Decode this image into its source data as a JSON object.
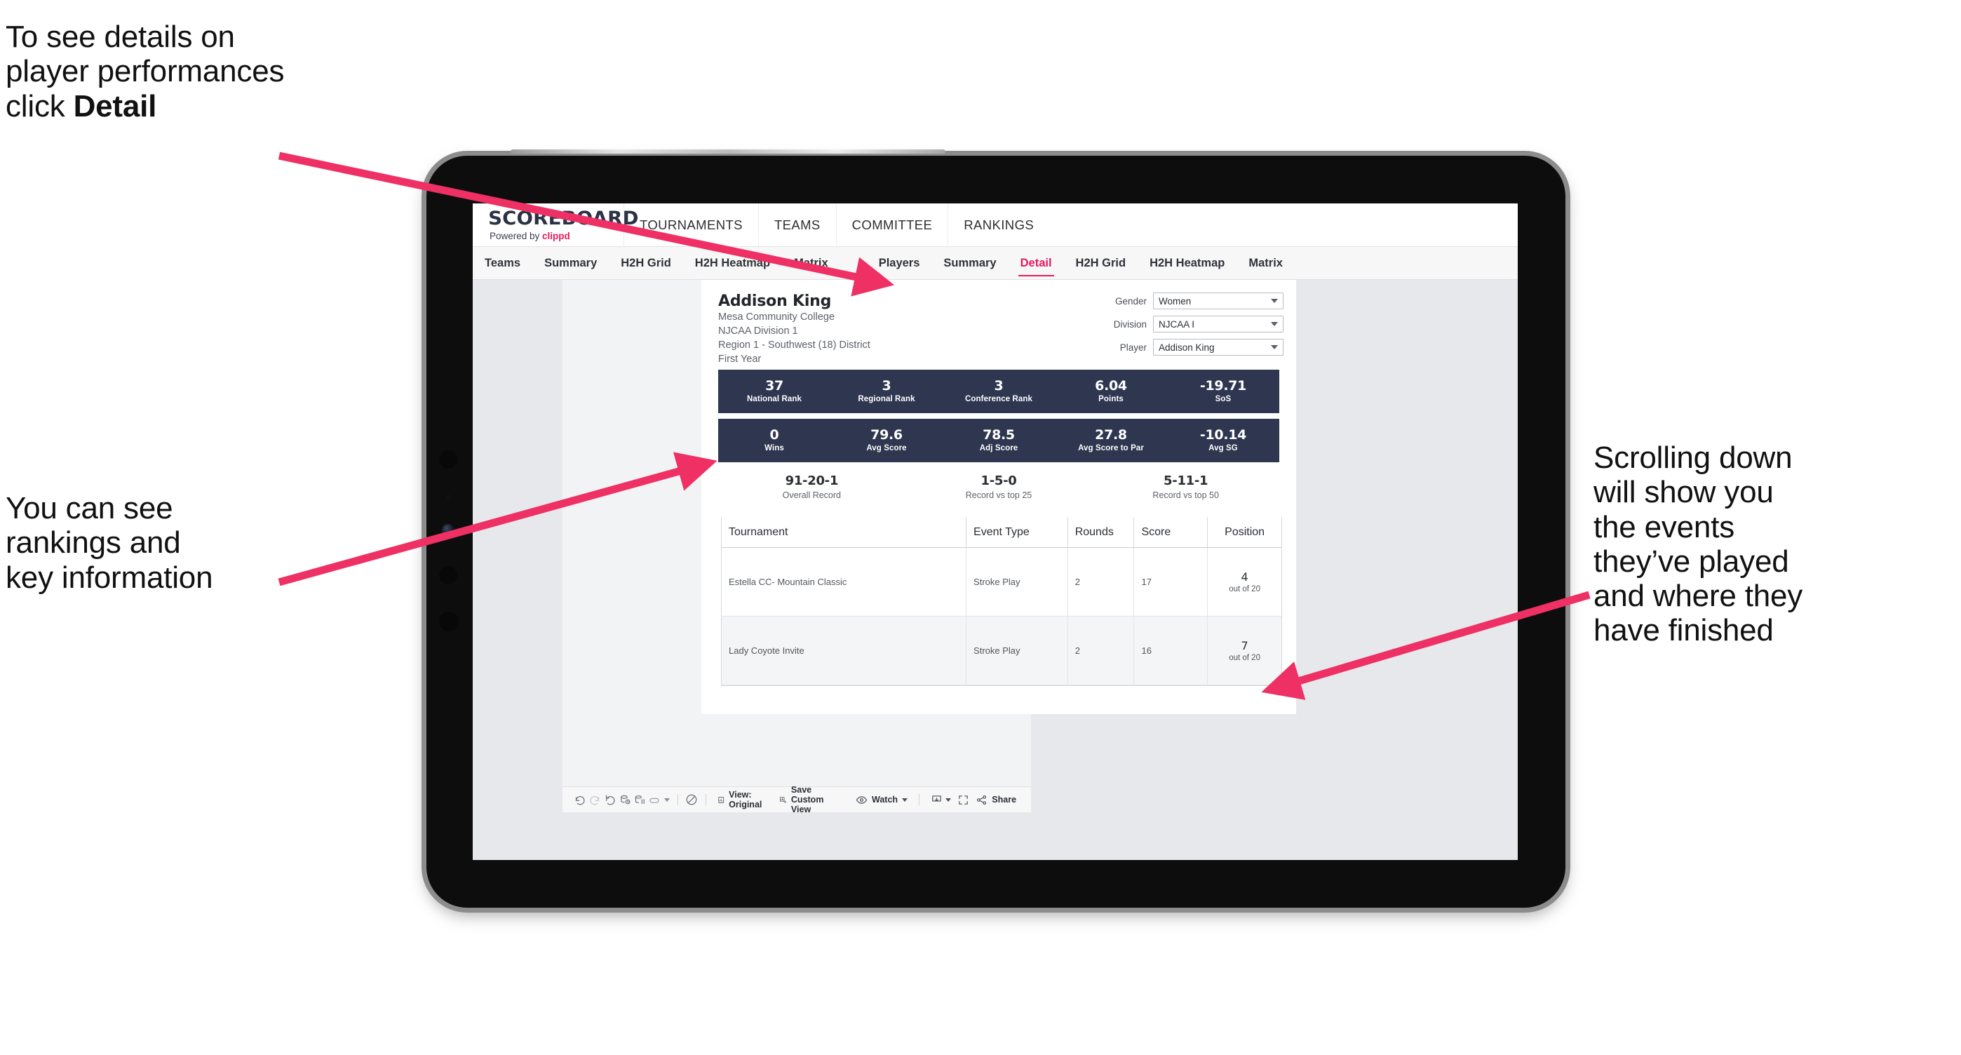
{
  "annotations": {
    "detail": {
      "line1": "To see details on",
      "line2": "player performances",
      "line3_pre": "click ",
      "line3_bold": "Detail"
    },
    "rankings": {
      "line1": "You can see",
      "line2": "rankings and",
      "line3": "key information"
    },
    "scrolling": {
      "line1": "Scrolling down",
      "line2": "will show you",
      "line3": "the events",
      "line4": "they’ve played",
      "line5": "and where they",
      "line6": "have finished"
    },
    "arrow_color": "#ee3064"
  },
  "app": {
    "logo": {
      "word": "SCOREBOARD",
      "powered_prefix": "Powered by ",
      "brand": "clippd"
    },
    "top_nav": [
      {
        "label": "TOURNAMENTS"
      },
      {
        "label": "TEAMS"
      },
      {
        "label": "COMMITTEE"
      },
      {
        "label": "RANKINGS"
      }
    ],
    "sub_nav_teams": [
      {
        "label": "Teams",
        "active": false
      },
      {
        "label": "Summary",
        "active": false
      },
      {
        "label": "H2H Grid",
        "active": false
      },
      {
        "label": "H2H Heatmap",
        "active": false
      },
      {
        "label": "Matrix",
        "active": false
      }
    ],
    "sub_nav_players": [
      {
        "label": "Players",
        "active": false
      },
      {
        "label": "Summary",
        "active": false
      },
      {
        "label": "Detail",
        "active": true
      },
      {
        "label": "H2H Grid",
        "active": false
      },
      {
        "label": "H2H Heatmap",
        "active": false
      },
      {
        "label": "Matrix",
        "active": false
      }
    ],
    "accent_color": "#e8195b",
    "statbar_color": "#2e3650"
  },
  "player": {
    "name": "Addison King",
    "school": "Mesa Community College",
    "division": "NJCAA Division 1",
    "region": "Region 1 - Southwest (18) District",
    "year": "First Year"
  },
  "filters": [
    {
      "label": "Gender",
      "value": "Women"
    },
    {
      "label": "Division",
      "value": "NJCAA I"
    },
    {
      "label": "Player",
      "value": "Addison King"
    }
  ],
  "stats_row_1": [
    {
      "value": "37",
      "label": "National Rank"
    },
    {
      "value": "3",
      "label": "Regional Rank"
    },
    {
      "value": "3",
      "label": "Conference Rank"
    },
    {
      "value": "6.04",
      "label": "Points"
    },
    {
      "value": "-19.71",
      "label": "SoS"
    }
  ],
  "stats_row_2": [
    {
      "value": "0",
      "label": "Wins"
    },
    {
      "value": "79.6",
      "label": "Avg Score"
    },
    {
      "value": "78.5",
      "label": "Adj Score"
    },
    {
      "value": "27.8",
      "label": "Avg Score to Par"
    },
    {
      "value": "-10.14",
      "label": "Avg SG"
    }
  ],
  "records": [
    {
      "value": "91-20-1",
      "label": "Overall Record"
    },
    {
      "value": "1-5-0",
      "label": "Record vs top 25"
    },
    {
      "value": "5-11-1",
      "label": "Record vs top 50"
    }
  ],
  "events_table": {
    "columns": [
      "Tournament",
      "Event Type",
      "Rounds",
      "Score",
      "Position"
    ],
    "rows": [
      {
        "tournament": "Estella CC- Mountain Classic",
        "event_type": "Stroke Play",
        "rounds": "2",
        "score": "17",
        "position": "4",
        "position_of": "out of 20"
      },
      {
        "tournament": "Lady Coyote Invite",
        "event_type": "Stroke Play",
        "rounds": "2",
        "score": "16",
        "position": "7",
        "position_of": "out of 20"
      }
    ]
  },
  "toolbar": {
    "view_label": "View: Original",
    "save_label": "Save Custom View",
    "watch_label": "Watch",
    "share_label": "Share"
  }
}
